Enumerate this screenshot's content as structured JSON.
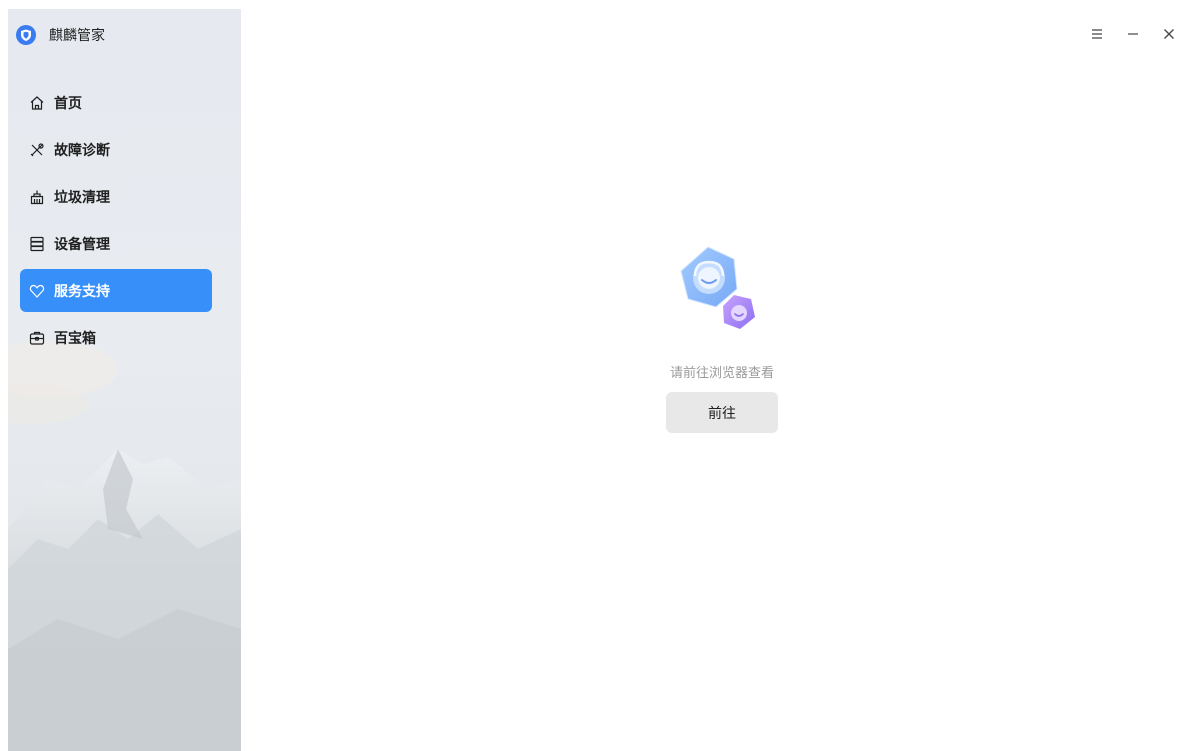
{
  "app": {
    "title": "麒麟管家",
    "logo_icon": "shield-icon"
  },
  "sidebar": {
    "items": [
      {
        "label": "首页",
        "icon": "home-icon",
        "active": false
      },
      {
        "label": "故障诊断",
        "icon": "tools-icon",
        "active": false
      },
      {
        "label": "垃圾清理",
        "icon": "broom-icon",
        "active": false
      },
      {
        "label": "设备管理",
        "icon": "device-icon",
        "active": false
      },
      {
        "label": "服务支持",
        "icon": "heart-icon",
        "active": true
      },
      {
        "label": "百宝箱",
        "icon": "toolbox-icon",
        "active": false
      }
    ]
  },
  "titlebar": {
    "menu_icon": "menu-icon",
    "minimize_icon": "minimize-icon",
    "close_icon": "close-icon"
  },
  "main": {
    "message": "请前往浏览器查看",
    "button_label": "前往",
    "illustration_icon": "customer-service-icon"
  },
  "colors": {
    "accent": "#3790fa",
    "sidebar_bg": "#e7ebf1",
    "button_bg": "#e8e8e8",
    "muted_text": "#9a9a9a"
  }
}
